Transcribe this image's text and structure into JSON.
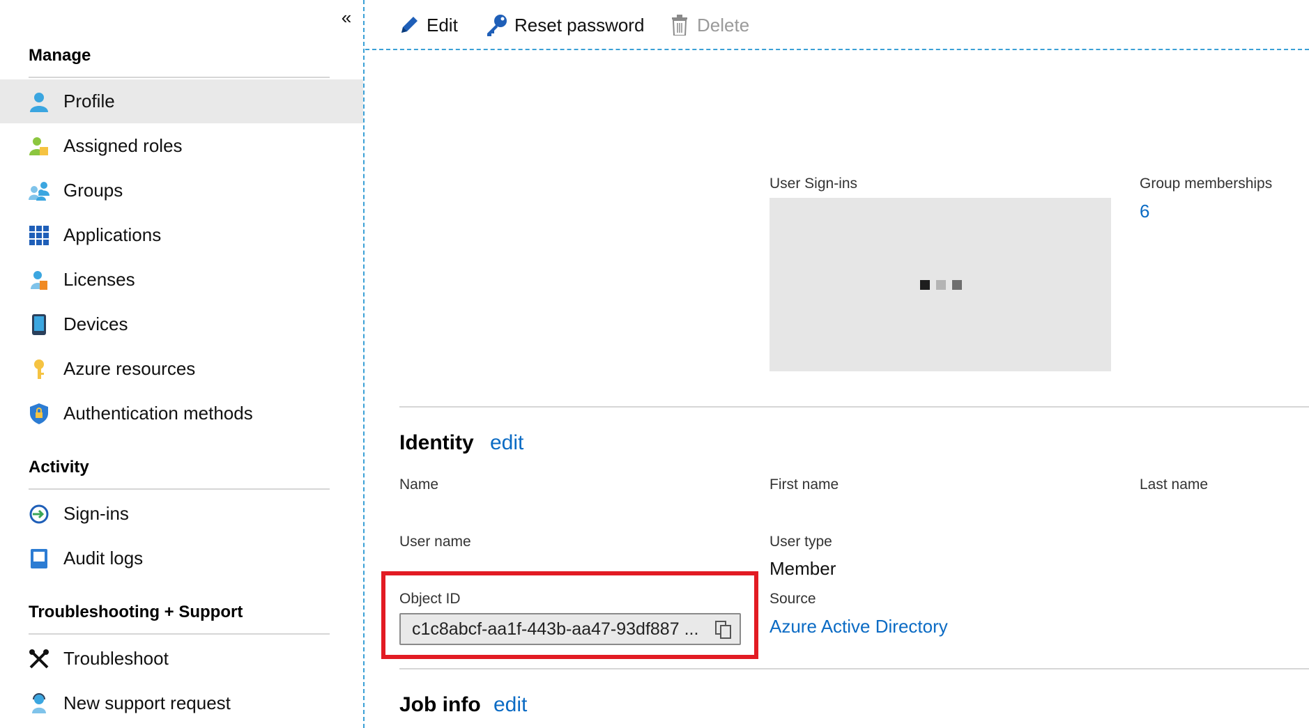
{
  "sidebar": {
    "collapse_icon": "double-chevron-left-icon",
    "sections": {
      "manage": "Manage",
      "activity": "Activity",
      "support": "Troubleshooting + Support"
    },
    "items": [
      {
        "label": "Profile",
        "icon": "user-icon",
        "selected": true
      },
      {
        "label": "Assigned roles",
        "icon": "roles-icon"
      },
      {
        "label": "Groups",
        "icon": "groups-icon"
      },
      {
        "label": "Applications",
        "icon": "grid-icon"
      },
      {
        "label": "Licenses",
        "icon": "license-icon"
      },
      {
        "label": "Devices",
        "icon": "device-icon"
      },
      {
        "label": "Azure resources",
        "icon": "key-icon"
      },
      {
        "label": "Authentication methods",
        "icon": "shield-icon"
      },
      {
        "label": "Sign-ins",
        "icon": "sign-in-icon"
      },
      {
        "label": "Audit logs",
        "icon": "log-icon"
      },
      {
        "label": "Troubleshoot",
        "icon": "tools-icon"
      },
      {
        "label": "New support request",
        "icon": "support-icon"
      }
    ]
  },
  "toolbar": {
    "edit": "Edit",
    "reset_password": "Reset password",
    "delete": "Delete"
  },
  "overview": {
    "sign_ins_label": "User Sign-ins",
    "group_memberships_label": "Group memberships",
    "group_memberships_value": "6"
  },
  "identity": {
    "title": "Identity",
    "edit_link": "edit",
    "name_label": "Name",
    "first_name_label": "First name",
    "last_name_label": "Last name",
    "user_name_label": "User name",
    "user_type_label": "User type",
    "user_type_value": "Member",
    "object_id_label": "Object ID",
    "object_id_value": "c1c8abcf-aa1f-443b-aa47-93df887 ...",
    "source_label": "Source",
    "source_value": "Azure Active Directory"
  },
  "job_info": {
    "title": "Job info",
    "edit_link": "edit"
  },
  "colors": {
    "link": "#0b6bc4",
    "highlight": "#e21b23",
    "accent_dashed": "#3aa0d6"
  }
}
